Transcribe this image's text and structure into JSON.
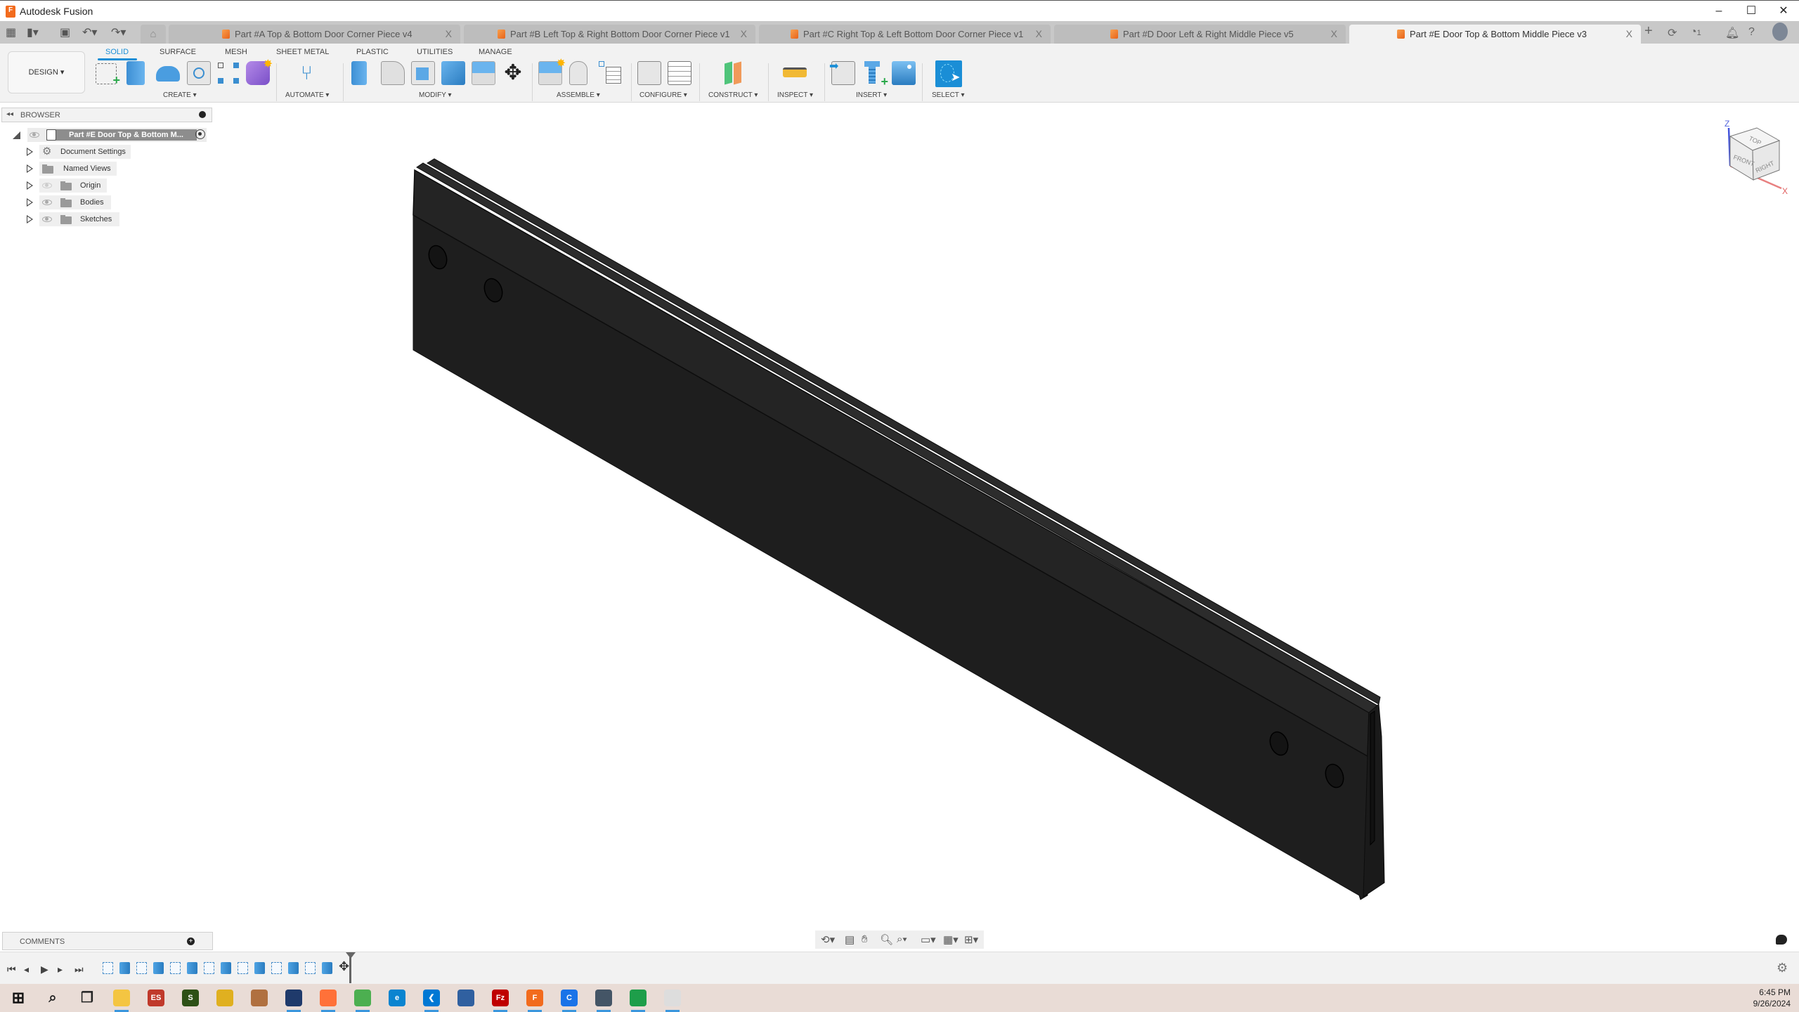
{
  "app": {
    "title": "Autodesk Fusion",
    "logo_letter": "F",
    "window_controls": {
      "minimize": "–",
      "maximize": "☐",
      "close": "✕"
    }
  },
  "tabbar": {
    "quick_access": [
      "grid-menu",
      "file-menu",
      "save",
      "undo",
      "redo"
    ],
    "tabs": [
      {
        "label": "Part #A Top & Bottom Door Corner Piece v4",
        "active": false
      },
      {
        "label": "Part #B Left Top & Right Bottom Door Corner Piece v1",
        "active": false
      },
      {
        "label": "Part #C Right Top & Left Bottom Door Corner Piece v1",
        "active": false
      },
      {
        "label": "Part #D Door Left & Right Middle Piece v5",
        "active": false
      },
      {
        "label": "Part #E Door Top & Bottom Middle Piece v3",
        "active": true
      }
    ],
    "close_glyph": "X",
    "new_tab": "+",
    "job_count": "1"
  },
  "toolbar": {
    "workspace": "DESIGN ▾",
    "workspace_tabs": [
      "SOLID",
      "SURFACE",
      "MESH",
      "SHEET METAL",
      "PLASTIC",
      "UTILITIES",
      "MANAGE"
    ],
    "active_tab": "SOLID",
    "groups": [
      {
        "label": "CREATE ▾",
        "tools": [
          "create-sketch",
          "extrude",
          "revolve",
          "hole",
          "rectangular-pattern",
          "create-form"
        ]
      },
      {
        "label": "AUTOMATE ▾",
        "tools": [
          "automated-modeling"
        ]
      },
      {
        "label": "MODIFY ▾",
        "tools": [
          "press-pull",
          "fillet",
          "shell",
          "combine",
          "split-body",
          "move-copy"
        ]
      },
      {
        "label": "ASSEMBLE ▾",
        "tools": [
          "new-component",
          "joint",
          "bill-of-materials"
        ]
      },
      {
        "label": "CONFIGURE ▾",
        "tools": [
          "configure-design",
          "configuration-table"
        ]
      },
      {
        "label": "CONSTRUCT ▾",
        "tools": [
          "offset-plane"
        ]
      },
      {
        "label": "INSPECT ▾",
        "tools": [
          "measure"
        ]
      },
      {
        "label": "INSERT ▾",
        "tools": [
          "insert-derive",
          "insert-mcmaster",
          "insert-canvas"
        ]
      },
      {
        "label": "SELECT ▾",
        "tools": [
          "select"
        ]
      }
    ]
  },
  "browser": {
    "header": "BROWSER",
    "root": "Part #E Door Top & Bottom M...",
    "items": [
      {
        "label": "Document Settings",
        "icon": "gear"
      },
      {
        "label": "Named Views",
        "icon": "folder"
      },
      {
        "label": "Origin",
        "icon": "folder",
        "visible": false
      },
      {
        "label": "Bodies",
        "icon": "folder",
        "visible": true
      },
      {
        "label": "Sketches",
        "icon": "folder",
        "visible": true
      }
    ]
  },
  "viewcube": {
    "faces": [
      "TOP",
      "FRONT",
      "RIGHT"
    ],
    "axes": [
      "Z",
      "X"
    ]
  },
  "comments": {
    "label": "COMMENTS"
  },
  "timeline": {
    "controls": [
      "first",
      "previous",
      "play",
      "next",
      "last"
    ],
    "features": [
      "sketch",
      "extrude",
      "sketch",
      "extrude",
      "sketch",
      "extrude",
      "sketch",
      "extrude",
      "sketch",
      "extrude",
      "sketch",
      "extrude",
      "sketch",
      "extrude",
      "move"
    ]
  },
  "navbar": {
    "tools": [
      "orbit",
      "look-at",
      "pan",
      "zoom",
      "fit",
      "display-settings",
      "grid-snaps",
      "viewports"
    ]
  },
  "taskbar": {
    "apps": [
      "start",
      "search",
      "task-view",
      "file-explorer",
      "es",
      "ss",
      "app-blue",
      "app-colorful",
      "virtualbox",
      "firefox",
      "chrome",
      "edge",
      "vscode",
      "network-tool",
      "filezilla",
      "fusion",
      "c-app",
      "calculator",
      "sheets",
      "inkscape"
    ],
    "time": "6:45 PM",
    "date": "9/26/2024"
  }
}
